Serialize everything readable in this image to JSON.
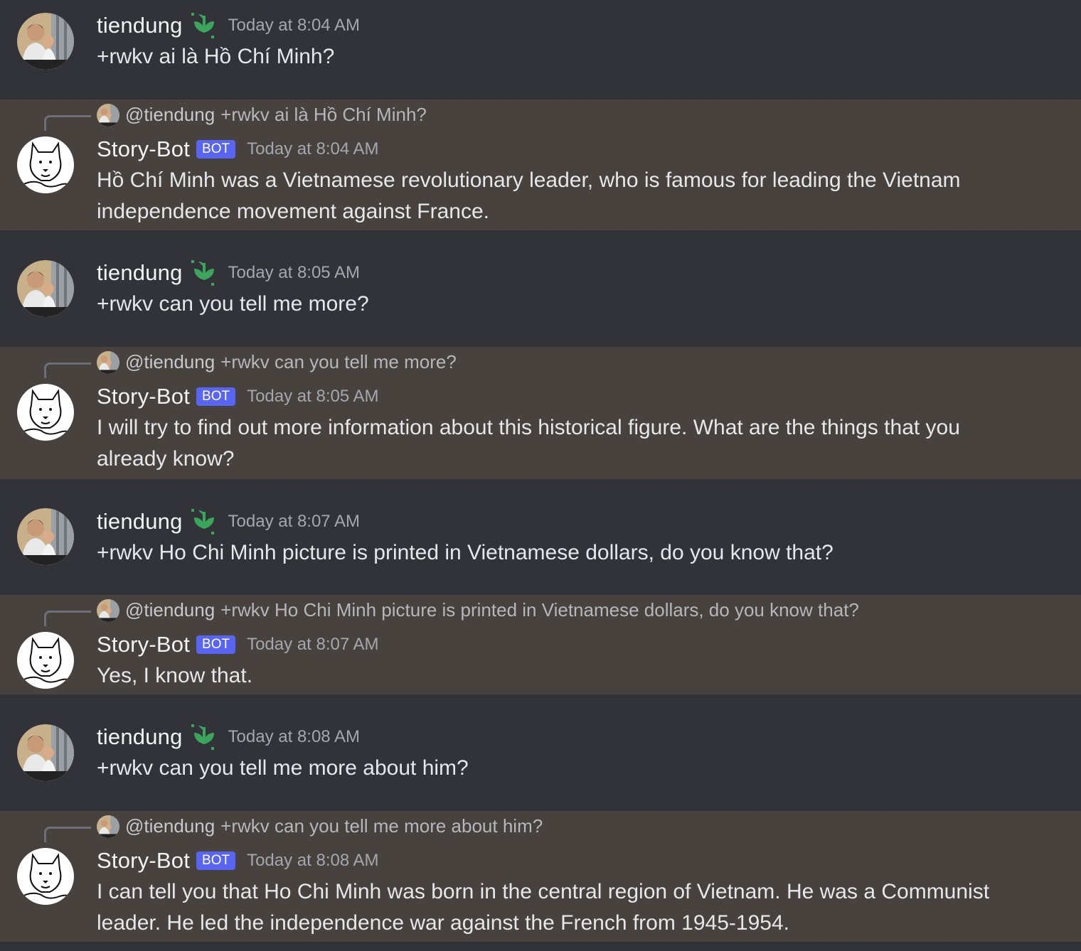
{
  "messages": [
    {
      "type": "user",
      "author": "tiendung",
      "time": "Today at 8:04 AM",
      "text": "+rwkv ai là Hồ Chí Minh?"
    },
    {
      "type": "bot",
      "reply_mention": "@tiendung",
      "reply_text": "+rwkv ai là Hồ Chí Minh?",
      "author": "Story-Bot",
      "badge": "BOT",
      "time": "Today at 8:04 AM",
      "text": "Hồ Chí Minh was a Vietnamese revolutionary leader, who is famous for leading the Vietnam independence movement against France."
    },
    {
      "type": "user",
      "author": "tiendung",
      "time": "Today at 8:05 AM",
      "text": "+rwkv can you tell me more?"
    },
    {
      "type": "bot",
      "reply_mention": "@tiendung",
      "reply_text": "+rwkv can you tell me more?",
      "author": "Story-Bot",
      "badge": "BOT",
      "time": "Today at 8:05 AM",
      "text": "I will try to find out more information about this historical figure. What are the things that you already know?"
    },
    {
      "type": "user",
      "author": "tiendung",
      "time": "Today at 8:07 AM",
      "text": "+rwkv Ho Chi Minh picture is printed in Vietnamese dollars, do you know that?"
    },
    {
      "type": "bot",
      "reply_mention": "@tiendung",
      "reply_text": "+rwkv Ho Chi Minh picture is printed in Vietnamese dollars, do you know that?",
      "author": "Story-Bot",
      "badge": "BOT",
      "time": "Today at 8:07 AM",
      "text": "Yes, I know that."
    },
    {
      "type": "user",
      "author": "tiendung",
      "time": "Today at 8:08 AM",
      "text": "+rwkv can you tell me more about him?"
    },
    {
      "type": "bot",
      "reply_mention": "@tiendung",
      "reply_text": "+rwkv can you tell me more about him?",
      "author": "Story-Bot",
      "badge": "BOT",
      "time": "Today at 8:08 AM",
      "text": "I can tell you that Ho Chi Minh was born in the central region of Vietnam. He was a Communist leader. He led the independence war against the French from 1945-1954."
    }
  ],
  "colors": {
    "bot_bg": "#47423d",
    "user_bg": "#313338",
    "badge": "#5865f2",
    "leaf": "#3ba55c"
  },
  "icons": {
    "user_avatar": "user-photo-avatar",
    "bot_avatar": "bear-sketch-avatar",
    "flair": "sprout-leaf-icon"
  }
}
